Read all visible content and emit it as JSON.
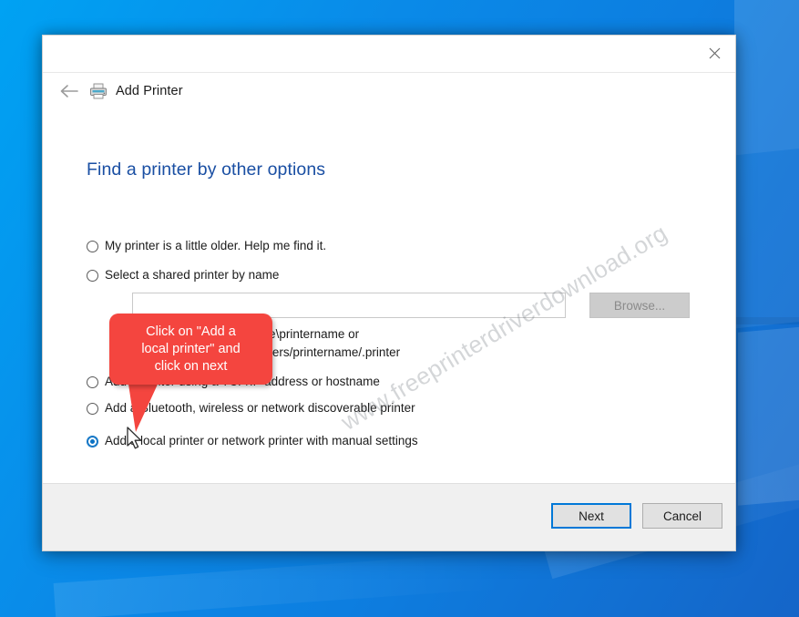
{
  "window": {
    "close_label": "✕",
    "nav_title": "Add Printer",
    "back_label": "←",
    "printer_icon": "printer-icon",
    "heading": "Find a printer by other options"
  },
  "options": [
    {
      "id": "older-printer",
      "label": "My printer is a little older. Help me find it.",
      "checked": false
    },
    {
      "id": "shared-printer-by-name",
      "label": "Select a shared printer by name",
      "checked": false
    },
    {
      "id": "tcpip-printer",
      "label": "Add a printer using a TCP/IP address or hostname",
      "checked": false
    },
    {
      "id": "bluetooth-printer",
      "label": "Add a Bluetooth, wireless or network discoverable printer",
      "checked": false
    },
    {
      "id": "local-printer",
      "label": "Add a local printer or network printer with manual settings",
      "checked": true
    }
  ],
  "shared_printer": {
    "input_value": "",
    "input_placeholder": "",
    "browse_label": "Browse...",
    "example_line1": "Example: \\\\computername\\printername or",
    "example_line2": "http://computername/printers/printername/.printer"
  },
  "footer": {
    "next_label": "Next",
    "cancel_label": "Cancel"
  },
  "callout": {
    "text": "Click on \"Add a\nlocal printer\" and\nclick on next",
    "background": "#f4453f",
    "text_color": "#ffffff"
  },
  "watermark": {
    "text": "www.freeprinterdriverdownload.org"
  },
  "colors": {
    "heading": "#1a4fa3",
    "accent": "#0078d7",
    "desktop_blue": "#0a8ae8",
    "radio_selected": "#0b72c4"
  }
}
